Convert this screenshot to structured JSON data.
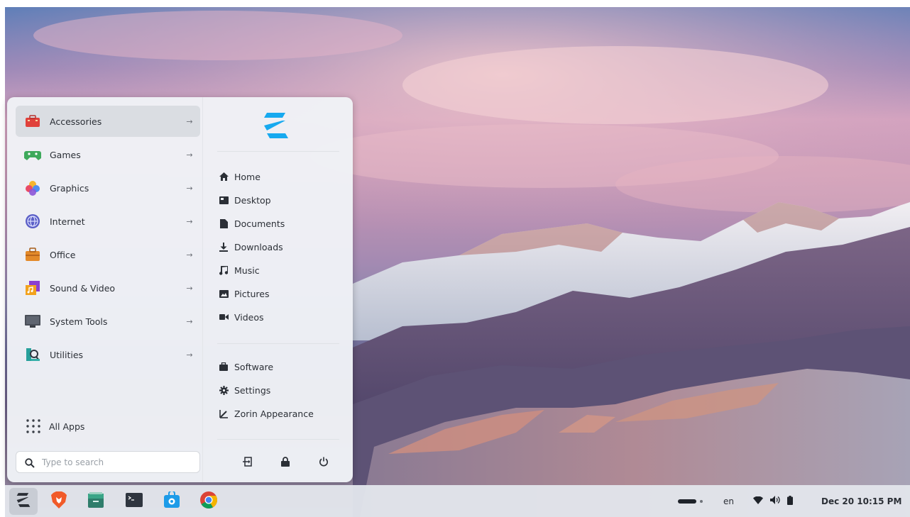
{
  "start_menu": {
    "categories": [
      {
        "label": "Accessories",
        "icon": "accessories-icon",
        "arrow": "→"
      },
      {
        "label": "Games",
        "icon": "games-icon",
        "arrow": "→"
      },
      {
        "label": "Graphics",
        "icon": "graphics-icon",
        "arrow": "→"
      },
      {
        "label": "Internet",
        "icon": "internet-icon",
        "arrow": "→"
      },
      {
        "label": "Office",
        "icon": "office-icon",
        "arrow": "→"
      },
      {
        "label": "Sound & Video",
        "icon": "sound-video-icon",
        "arrow": "→"
      },
      {
        "label": "System Tools",
        "icon": "system-tools-icon",
        "arrow": "→"
      },
      {
        "label": "Utilities",
        "icon": "utilities-icon",
        "arrow": "→"
      }
    ],
    "all_apps_label": "All Apps",
    "search": {
      "placeholder": "Type to search",
      "value": ""
    },
    "places": [
      {
        "label": "Home",
        "icon": "home-icon"
      },
      {
        "label": "Desktop",
        "icon": "desktop-icon"
      },
      {
        "label": "Documents",
        "icon": "document-icon"
      },
      {
        "label": "Downloads",
        "icon": "download-icon"
      },
      {
        "label": "Music",
        "icon": "music-icon"
      },
      {
        "label": "Pictures",
        "icon": "picture-icon"
      },
      {
        "label": "Videos",
        "icon": "video-icon"
      }
    ],
    "system_links": [
      {
        "label": "Software",
        "icon": "software-icon"
      },
      {
        "label": "Settings",
        "icon": "settings-icon"
      },
      {
        "label": "Zorin Appearance",
        "icon": "appearance-icon"
      }
    ],
    "session_buttons": [
      "logout-icon",
      "lock-icon",
      "power-icon"
    ]
  },
  "taskbar": {
    "apps": [
      "zorin-menu-icon",
      "brave-browser-icon",
      "files-icon",
      "terminal-icon",
      "software-store-icon",
      "chrome-icon"
    ],
    "keyboard_layout": "en",
    "clock": "Dec 20 10:15 PM"
  },
  "colors": {
    "accent": "#15a6f0",
    "menu_bg": "#f0f2f6",
    "active_item": "#dadde2",
    "taskbar_bg": "#e2e5eb"
  }
}
